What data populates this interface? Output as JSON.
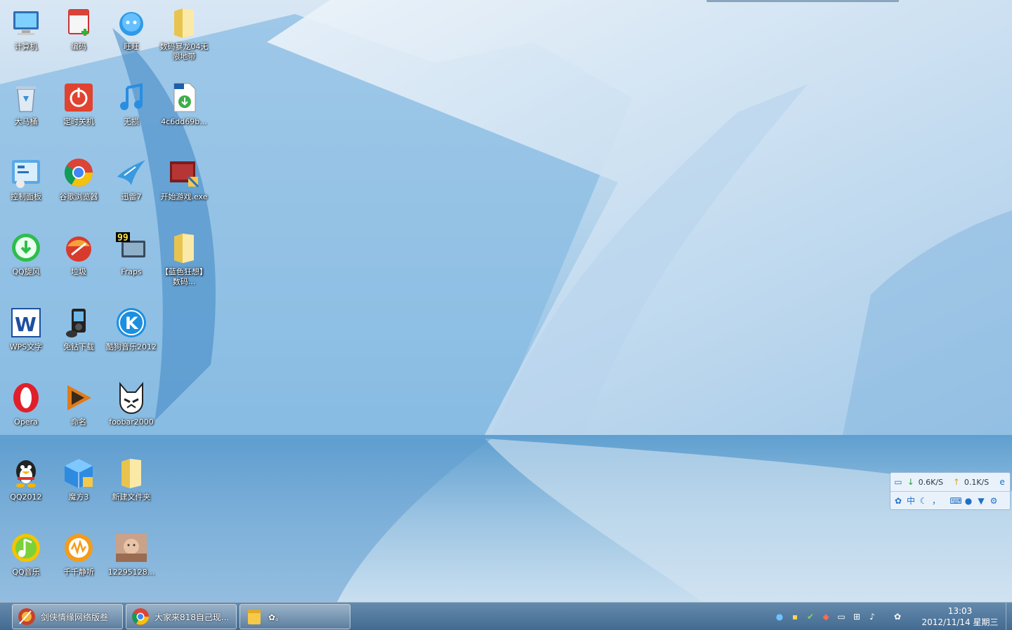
{
  "desktop": {
    "icons": [
      {
        "label": "计算机",
        "icon": "computer-icon"
      },
      {
        "label": "编码",
        "icon": "notepad-icon"
      },
      {
        "label": "旺旺",
        "icon": "wangwang-icon"
      },
      {
        "label": "数码暴龙04无限地带",
        "icon": "folder-icon"
      },
      {
        "label": "大马桶",
        "icon": "recycle-bin-icon"
      },
      {
        "label": "定时关机",
        "icon": "power-icon"
      },
      {
        "label": "无损",
        "icon": "music-note-icon"
      },
      {
        "label": "4c6dd69b...",
        "icon": "torrent-file-icon"
      },
      {
        "label": "控制面板",
        "icon": "control-panel-icon"
      },
      {
        "label": "谷歌浏览器",
        "icon": "chrome-icon"
      },
      {
        "label": "迅雷7",
        "icon": "thunder-icon"
      },
      {
        "label": "开始游戏.exe",
        "icon": "game-exe-icon"
      },
      {
        "label": "QQ旋风",
        "icon": "qq-whirlwind-icon"
      },
      {
        "label": "垃圾",
        "icon": "cleaner-icon"
      },
      {
        "label": "Fraps",
        "icon": "fraps-icon"
      },
      {
        "label": "【蓝色狂想】数码...",
        "icon": "folder-icon"
      },
      {
        "label": "WPS文字",
        "icon": "wps-writer-icon"
      },
      {
        "label": "免钻下载",
        "icon": "media-player-icon"
      },
      {
        "label": "酷狗音乐2012",
        "icon": "kugou-icon"
      },
      {
        "label": "Opera",
        "icon": "opera-icon"
      },
      {
        "label": "命名",
        "icon": "play-icon"
      },
      {
        "label": "foobar2000",
        "icon": "foobar-icon"
      },
      {
        "label": "QQ2012",
        "icon": "qq-penguin-icon"
      },
      {
        "label": "魔方3",
        "icon": "cube-icon"
      },
      {
        "label": "新建文件夹",
        "icon": "folder-icon"
      },
      {
        "label": "QQ音乐",
        "icon": "qq-music-icon"
      },
      {
        "label": "千千静听",
        "icon": "ttplayer-icon"
      },
      {
        "label": "12295128...",
        "icon": "photo-thumbnail-icon"
      }
    ]
  },
  "widget": {
    "download_speed": "0.6K/S",
    "upload_speed": "0.1K/S",
    "ime_mode": "中",
    "ime_punct": "，"
  },
  "taskbar": {
    "tasks": [
      {
        "label": "剑侠情缘网络版叁",
        "icon": "jx3-icon"
      },
      {
        "label": "大家来818自己现...",
        "icon": "chrome-icon"
      },
      {
        "label": "✿。",
        "icon": "sticky-note-icon"
      }
    ],
    "clock": {
      "time": "13:03",
      "date": "2012/11/14 星期三"
    }
  },
  "colors": {
    "taskbar": "#4f7ba3",
    "ice": "#7fb3dc",
    "label_text": "#ffffff"
  }
}
